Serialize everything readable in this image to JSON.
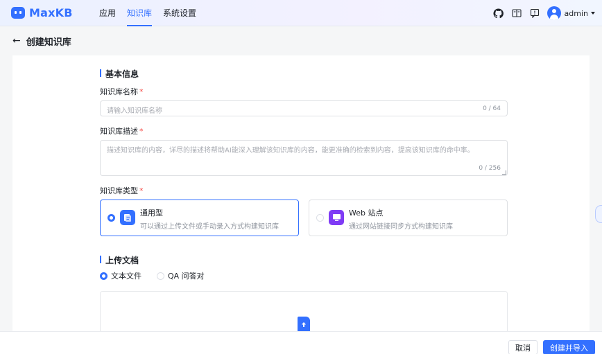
{
  "app": {
    "logo_text": "MaxKB"
  },
  "nav": {
    "items": [
      {
        "label": "应用",
        "active": false
      },
      {
        "label": "知识库",
        "active": true
      },
      {
        "label": "系统设置",
        "active": false
      }
    ]
  },
  "topbar": {
    "icons": [
      "github-icon",
      "book-icon",
      "feedback-icon"
    ],
    "user_name": "admin"
  },
  "page": {
    "back_arrow": "←",
    "title": "创建知识库"
  },
  "basic_info": {
    "title": "基本信息",
    "name_label": "知识库名称",
    "name_placeholder": "请输入知识库名称",
    "name_counter": "0 / 64",
    "desc_label": "知识库描述",
    "desc_placeholder": "描述知识库的内容，详尽的描述将帮助AI能深入理解该知识库的内容，能更准确的检索到内容，提高该知识库的命中率。",
    "desc_counter": "0 / 256",
    "type_label": "知识库类型",
    "required_mark": "*",
    "types": [
      {
        "title": "通用型",
        "desc": "可以通过上传文件或手动录入方式构建知识库",
        "selected": true,
        "color": "#3370ff"
      },
      {
        "title": "Web 站点",
        "desc": "通过网站链接同步方式构建知识库",
        "selected": false,
        "color": "#7f3bf5"
      }
    ]
  },
  "upload": {
    "title": "上传文档",
    "options": [
      {
        "label": "文本文件",
        "selected": true
      },
      {
        "label": "QA 问答对",
        "selected": false
      }
    ]
  },
  "footer": {
    "cancel_label": "取消",
    "submit_label": "创建并导入"
  },
  "colors": {
    "accent": "#3370ff",
    "purple": "#7f3bf5",
    "required": "#f54a45"
  }
}
